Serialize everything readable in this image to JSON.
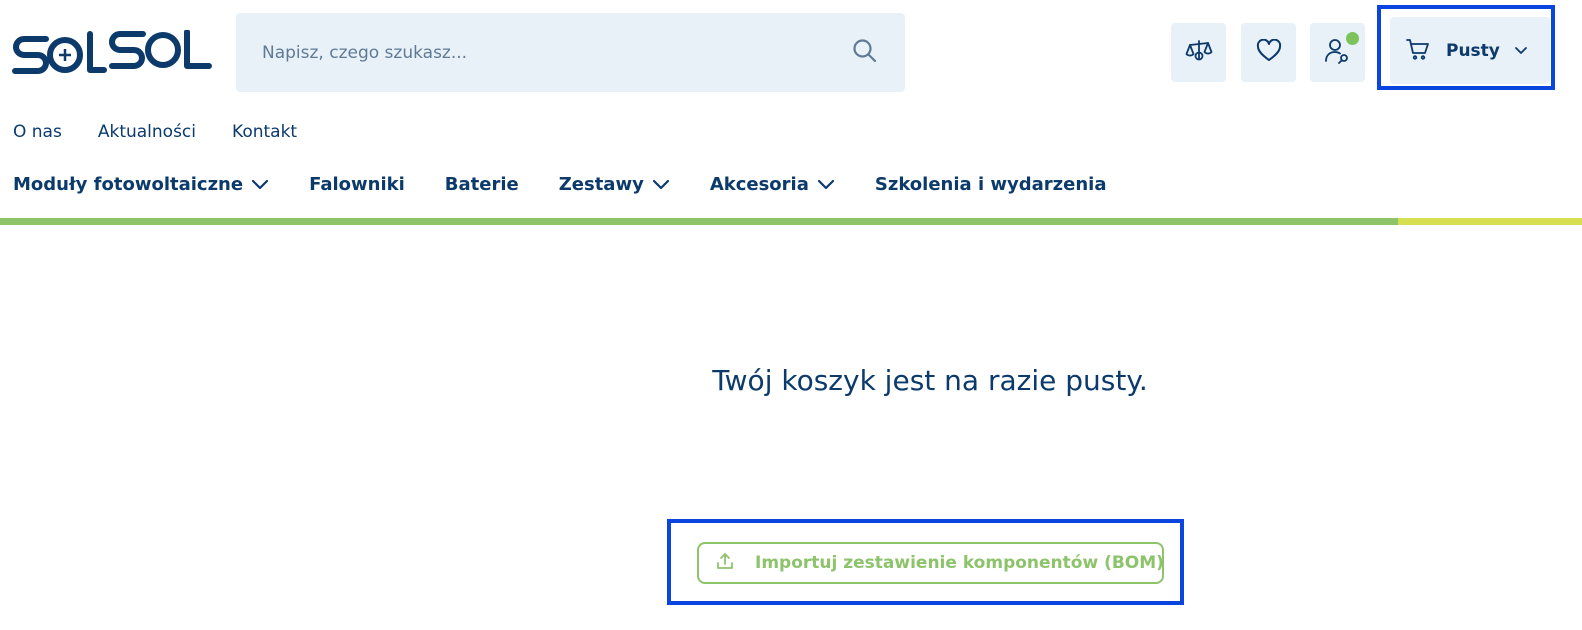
{
  "brand": {
    "logo_text": "SOLSOL",
    "primary_color": "#0b3a6b",
    "accent_green": "#8dc36b",
    "accent_yellow": "#d6df4f",
    "highlight_color": "#0a45e0"
  },
  "header": {
    "search": {
      "placeholder": "Napisz, czego szukasz...",
      "icon": "search-icon"
    },
    "actions": [
      {
        "name": "compare",
        "icon": "balance-scale-icon"
      },
      {
        "name": "favorites",
        "icon": "heart-icon"
      },
      {
        "name": "account",
        "icon": "user-icon",
        "status": "online"
      }
    ],
    "cart": {
      "label": "Pusty",
      "icon": "cart-icon",
      "chevron": "chevron-down-icon"
    }
  },
  "top_links": [
    "O nas",
    "Aktualności",
    "Kontakt"
  ],
  "main_nav": [
    {
      "label": "Moduły fotowoltaiczne",
      "has_dropdown": true
    },
    {
      "label": "Falowniki",
      "has_dropdown": false
    },
    {
      "label": "Baterie",
      "has_dropdown": false
    },
    {
      "label": "Zestawy",
      "has_dropdown": true
    },
    {
      "label": "Akcesoria",
      "has_dropdown": true
    },
    {
      "label": "Szkolenia i wydarzenia",
      "has_dropdown": false
    }
  ],
  "cart_page": {
    "empty_message": "Twój koszyk jest na razie pusty.",
    "import_button_label": "Importuj zestawienie komponentów (BOM)",
    "import_icon": "upload-icon"
  }
}
